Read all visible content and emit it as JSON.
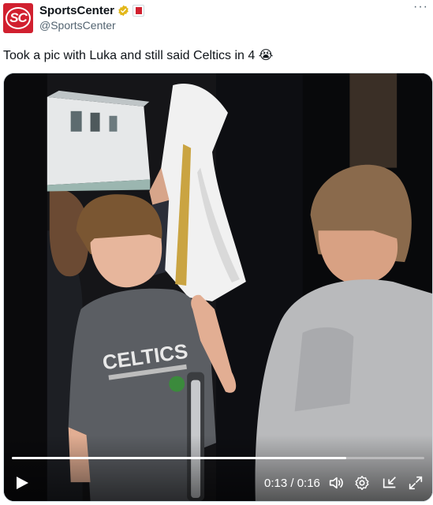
{
  "header": {
    "avatar_text": "SC",
    "display_name": "SportsCenter",
    "handle": "@SportsCenter",
    "more_label": "···"
  },
  "tweet": {
    "text": "Took a pic with Luka and still said Celtics in 4 😭"
  },
  "video": {
    "shirt_text": "CELTICS",
    "time_label": "0:13 / 0:16",
    "progress": 0.81,
    "icons": [
      "play-icon",
      "volume-icon",
      "settings-icon",
      "pip-icon",
      "fullscreen-icon"
    ]
  },
  "colors": {
    "brand": "#d1202f",
    "verified": "#e2b719",
    "text": "#0f1419",
    "muted": "#536471"
  }
}
